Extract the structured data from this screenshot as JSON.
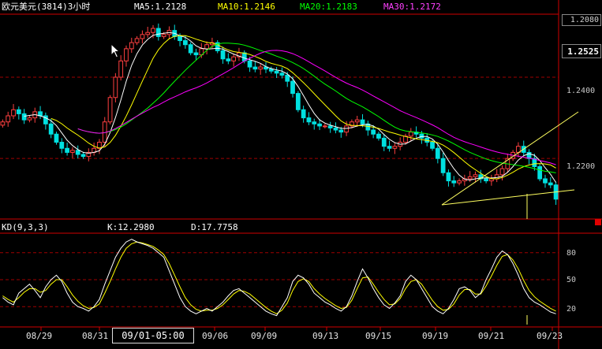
{
  "header": {
    "symbol": "欧元美元(3814)3小时",
    "ma5": "MA5:1.2128",
    "ma10": "MA10:1.2146",
    "ma20": "MA20:1.2183",
    "ma30": "MA30:1.2172"
  },
  "kd_header": {
    "name": "KD(9,3,3)",
    "k": "K:12.2980",
    "d": "D:17.7758"
  },
  "price_axis": {
    "top_value": "1.2080",
    "current": "1.2525",
    "labels": [
      "1.2400",
      "1.2200"
    ]
  },
  "kd_axis": {
    "labels": [
      "80",
      "50",
      "20"
    ]
  },
  "date_axis": [
    "08/29",
    "08/31",
    "09/06",
    "09/09",
    "09/13",
    "09/15",
    "09/19",
    "09/21",
    "09/23"
  ],
  "cursor_time": "09/01-05:00",
  "colors": {
    "ma5": "#ffffff",
    "ma10": "#ffff00",
    "ma20": "#00ff00",
    "ma30": "#ff00ff",
    "candle": "#00e0e0",
    "gridline": "#a00000",
    "k_line": "#ffffff",
    "d_line": "#ffff00",
    "trendline": "#ffff60"
  },
  "chart_data": {
    "type": "candlestick",
    "ylim_price": [
      1.2055,
      1.2555
    ],
    "ylim_kd": [
      0,
      100
    ],
    "close": [
      1.229,
      1.2305,
      1.232,
      1.231,
      1.2295,
      1.23,
      1.2315,
      1.2305,
      1.2285,
      1.226,
      1.224,
      1.2225,
      1.2215,
      1.222,
      1.221,
      1.2205,
      1.2215,
      1.2225,
      1.224,
      1.229,
      1.235,
      1.24,
      1.244,
      1.247,
      1.2485,
      1.2495,
      1.2505,
      1.251,
      1.252,
      1.25,
      1.2505,
      1.2515,
      1.25,
      1.249,
      1.248,
      1.246,
      1.2455,
      1.247,
      1.248,
      1.2485,
      1.2465,
      1.2445,
      1.244,
      1.245,
      1.246,
      1.244,
      1.2425,
      1.242,
      1.2425,
      1.242,
      1.2415,
      1.241,
      1.2405,
      1.239,
      1.236,
      1.232,
      1.23,
      1.229,
      1.2285,
      1.228,
      1.228,
      1.2275,
      1.227,
      1.2265,
      1.228,
      1.229,
      1.2295,
      1.2285,
      1.227,
      1.226,
      1.225,
      1.223,
      1.2225,
      1.223,
      1.224,
      1.2255,
      1.2265,
      1.226,
      1.225,
      1.224,
      1.2225,
      1.22,
      1.2165,
      1.2145,
      1.214,
      1.2145,
      1.215,
      1.2155,
      1.216,
      1.215,
      1.2145,
      1.215,
      1.216,
      1.2175,
      1.22,
      1.2215,
      1.223,
      1.2215,
      1.22,
      1.218,
      1.215,
      1.214,
      1.2135,
      1.21
    ],
    "k": [
      30,
      25,
      22,
      35,
      40,
      45,
      38,
      30,
      42,
      50,
      55,
      48,
      35,
      25,
      20,
      18,
      15,
      20,
      28,
      45,
      60,
      75,
      85,
      92,
      95,
      92,
      90,
      88,
      85,
      80,
      75,
      60,
      45,
      30,
      20,
      15,
      12,
      15,
      18,
      15,
      20,
      25,
      32,
      38,
      40,
      35,
      30,
      25,
      20,
      15,
      12,
      10,
      20,
      30,
      48,
      55,
      52,
      45,
      35,
      30,
      25,
      22,
      18,
      15,
      20,
      32,
      48,
      62,
      52,
      40,
      30,
      22,
      18,
      24,
      32,
      48,
      55,
      50,
      40,
      30,
      20,
      15,
      12,
      18,
      28,
      40,
      42,
      38,
      30,
      35,
      50,
      62,
      75,
      82,
      78,
      68,
      55,
      40,
      30,
      25,
      22,
      18,
      14,
      12
    ],
    "d": [
      32,
      28,
      25,
      30,
      36,
      40,
      40,
      36,
      38,
      45,
      50,
      50,
      42,
      33,
      26,
      21,
      18,
      19,
      23,
      35,
      48,
      62,
      75,
      85,
      90,
      92,
      91,
      89,
      87,
      83,
      78,
      68,
      55,
      42,
      30,
      22,
      17,
      15,
      16,
      16,
      18,
      22,
      28,
      34,
      38,
      37,
      34,
      29,
      24,
      19,
      15,
      12,
      16,
      24,
      38,
      48,
      51,
      48,
      40,
      34,
      29,
      25,
      21,
      18,
      19,
      27,
      40,
      52,
      53,
      45,
      36,
      28,
      22,
      23,
      29,
      40,
      48,
      50,
      45,
      36,
      27,
      20,
      16,
      17,
      23,
      33,
      39,
      39,
      34,
      34,
      43,
      54,
      66,
      76,
      78,
      72,
      62,
      49,
      38,
      31,
      26,
      22,
      18,
      15
    ],
    "x_ticks": [
      "08/29",
      "08/31",
      "09/06",
      "09/09",
      "09/13",
      "09/15",
      "09/19",
      "09/21",
      "09/23"
    ]
  }
}
